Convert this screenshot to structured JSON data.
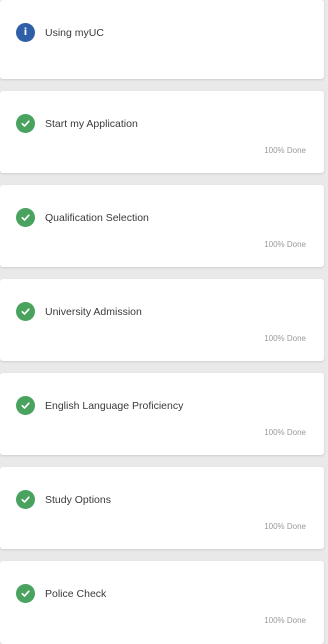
{
  "steps": [
    {
      "title": "Using myUC",
      "icon": "info-icon",
      "status": ""
    },
    {
      "title": "Start my Application",
      "icon": "check-circle-icon",
      "status": "100% Done"
    },
    {
      "title": "Qualification Selection",
      "icon": "check-circle-icon",
      "status": "100% Done"
    },
    {
      "title": "University Admission",
      "icon": "check-circle-icon",
      "status": "100% Done"
    },
    {
      "title": "English Language Proficiency",
      "icon": "check-circle-icon",
      "status": "100% Done"
    },
    {
      "title": "Study Options",
      "icon": "check-circle-icon",
      "status": "100% Done"
    },
    {
      "title": "Police Check",
      "icon": "check-circle-icon",
      "status": "100% Done"
    }
  ],
  "info_glyph": "i",
  "colors": {
    "info": "#2f5fa7",
    "complete": "#49a35f",
    "background": "#e9e9e9"
  }
}
